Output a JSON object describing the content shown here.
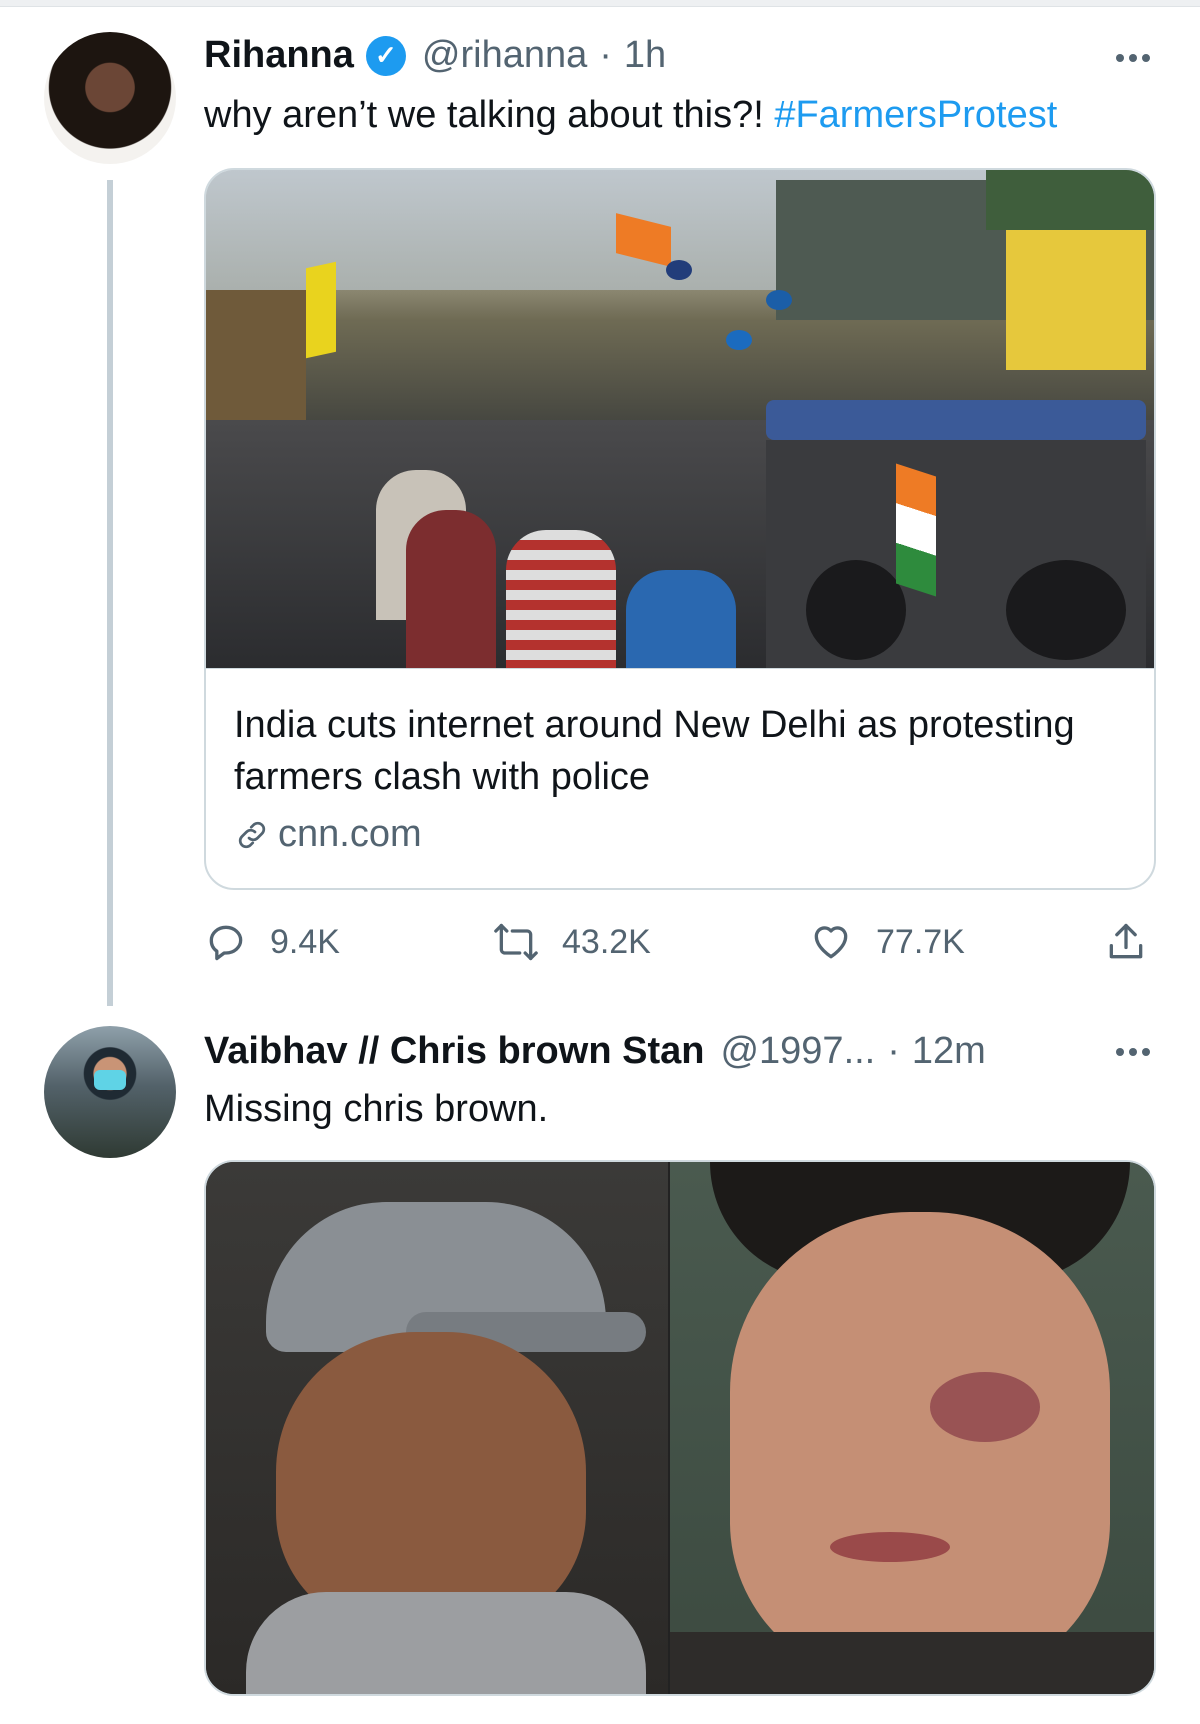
{
  "tweets": [
    {
      "name": "Rihanna",
      "verified_icon": "verified-badge-icon",
      "handle": "@rihanna",
      "separator": "·",
      "time": "1h",
      "text_main": "why aren’t we talking about this?! ",
      "hashtag": "#FarmersProtest",
      "card": {
        "title": "India cuts internet around New Delhi as protesting farmers clash with police",
        "domain": "cnn.com"
      },
      "actions": {
        "replies": "9.4K",
        "retweets": "43.2K",
        "likes": "77.7K"
      }
    },
    {
      "name": "Vaibhav // Chris brown Stan",
      "handle": "@1997...",
      "separator": "·",
      "time": "12m",
      "text_main": "Missing chris brown."
    }
  ],
  "colors": {
    "link": "#1d9bf0",
    "secondary_text": "#536471",
    "border": "#cfd9de"
  }
}
